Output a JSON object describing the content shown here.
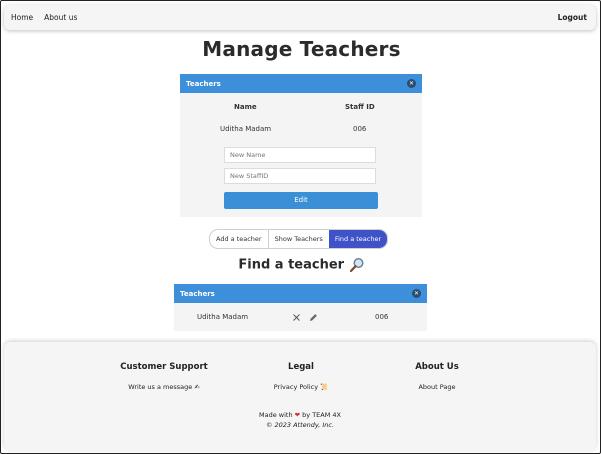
{
  "navbar": {
    "links": [
      "Home",
      "About us"
    ],
    "logout": "Logout"
  },
  "page_title": "Manage Teachers",
  "teachers_panel": {
    "title": "Teachers",
    "col_name": "Name",
    "col_staff_id": "Staff ID",
    "row": {
      "name": "Uditha Madam",
      "staff_id": "006"
    },
    "new_name_placeholder": "New Name",
    "new_staff_id_placeholder": "New StaffID",
    "edit_label": "Edit"
  },
  "tabs": [
    "Add a teacher",
    "Show Teachers",
    "Find a teacher"
  ],
  "active_tab": "Find a teacher",
  "find_title": "Find a teacher",
  "find_panel": {
    "title": "Teachers",
    "row": {
      "name": "Uditha Madam",
      "staff_id": "006"
    }
  },
  "footer": {
    "customer_support": {
      "heading": "Customer Support",
      "link": "Write us a message ✍"
    },
    "legal": {
      "heading": "Legal",
      "link": "Privacy Policy 📜"
    },
    "about": {
      "heading": "About Us",
      "link": "About Page"
    },
    "made_with_prefix": "Made with",
    "made_with_suffix": "by TEAM 4X",
    "copyright": "© 2023 Attendy, Inc."
  },
  "colors": {
    "panel_header": "#3c8fd8",
    "edit_button": "#3a8fd6",
    "active_tab": "#4052c8",
    "heart": "#d32f2f"
  },
  "icons": [
    "close-icon",
    "magnifier-icon",
    "delete-icon",
    "edit-pencil-icon",
    "heart-icon"
  ]
}
